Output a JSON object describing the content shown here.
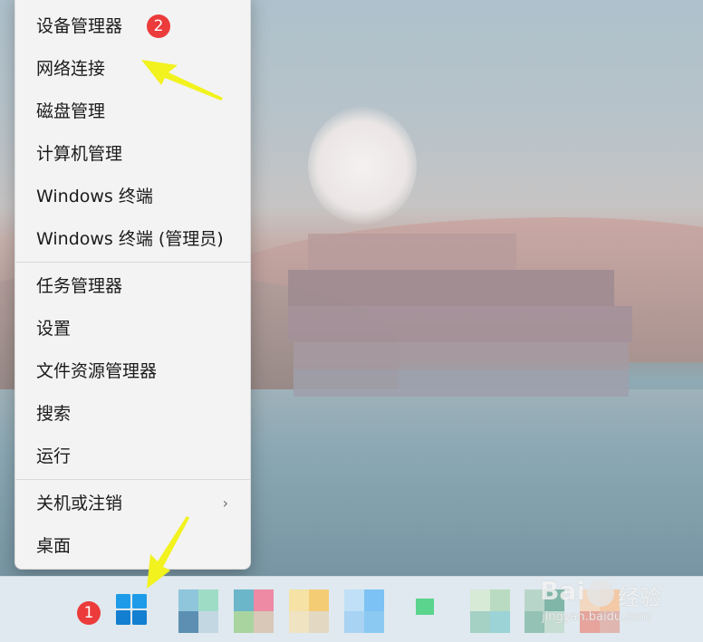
{
  "context_menu": {
    "items": [
      {
        "label": "设备管理器"
      },
      {
        "label": "网络连接"
      },
      {
        "label": "磁盘管理"
      },
      {
        "label": "计算机管理"
      },
      {
        "label": "Windows 终端"
      },
      {
        "label": "Windows 终端 (管理员)"
      },
      {
        "label": "任务管理器"
      },
      {
        "label": "设置"
      },
      {
        "label": "文件资源管理器"
      },
      {
        "label": "搜索"
      },
      {
        "label": "运行"
      },
      {
        "label": "关机或注销"
      },
      {
        "label": "桌面"
      }
    ],
    "submenu_indicator": "›"
  },
  "annotations": {
    "badge_1": "1",
    "badge_2": "2"
  },
  "taskbar": {
    "start_icon": "windows-logo-icon",
    "accent_color": "#1a8ce0"
  },
  "watermark": {
    "brand": "Bai",
    "brand_cn": "经验",
    "url": "jingyan.baidu.com"
  }
}
